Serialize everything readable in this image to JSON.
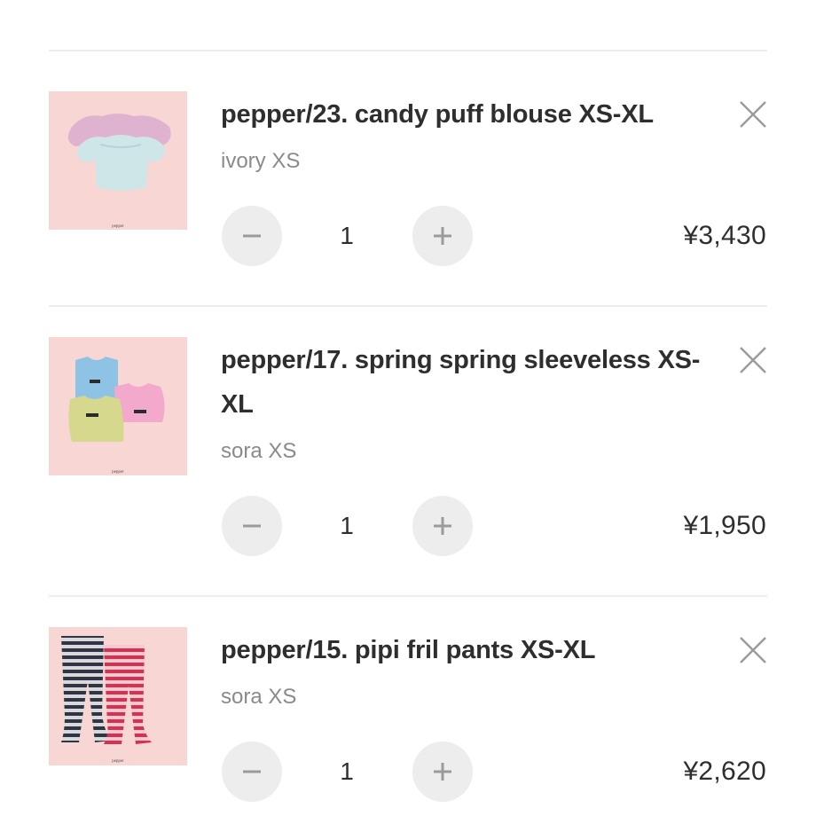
{
  "cart": {
    "items": [
      {
        "title": "pepper/23. candy puff blouse XS-XL",
        "variant": "ivory XS",
        "quantity": "1",
        "price": "¥3,430",
        "thumb_brand": "pepper"
      },
      {
        "title": "pepper/17. spring spring sleeveless XS-XL",
        "variant": "sora XS",
        "quantity": "1",
        "price": "¥1,950",
        "thumb_brand": "pepper"
      },
      {
        "title": "pepper/15. pipi fril pants XS-XL",
        "variant": "sora XS",
        "quantity": "1",
        "price": "¥2,620",
        "thumb_brand": "pepper"
      }
    ]
  },
  "icons": {
    "remove": "close-icon",
    "decrease": "minus-icon",
    "increase": "plus-icon"
  },
  "colors": {
    "thumb_bg": "#f7d6d4",
    "button_bg": "#ededed",
    "divider": "#ececec"
  }
}
